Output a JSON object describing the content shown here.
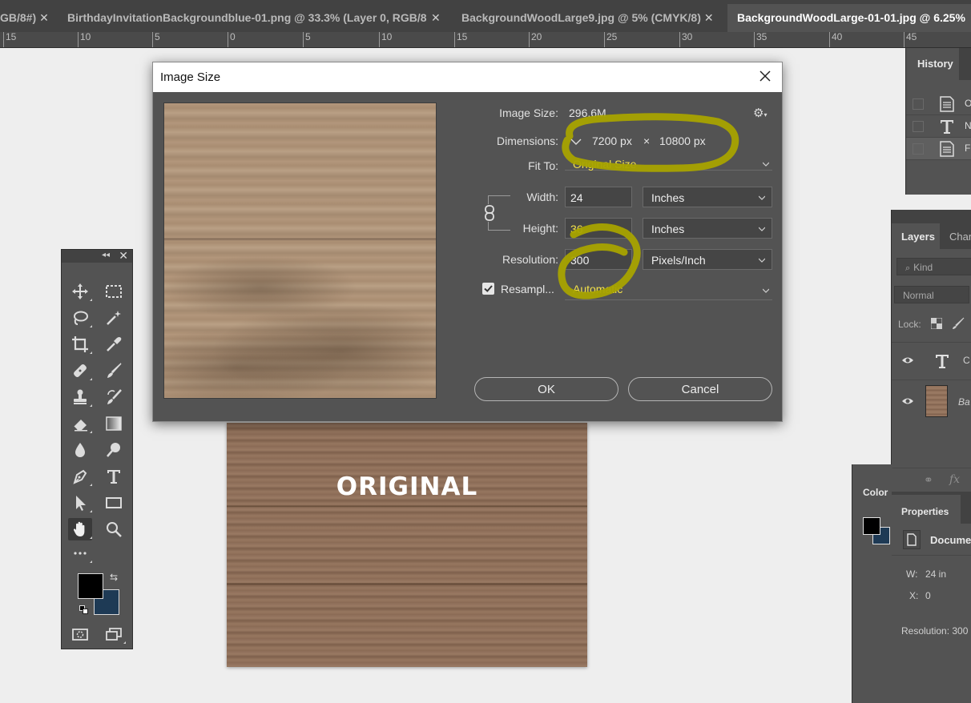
{
  "tabs": [
    {
      "label": "GB/8#)",
      "close": "✕"
    },
    {
      "label": "BirthdayInvitationBackgroundblue-01.png @ 33.3% (Layer 0, RGB/8",
      "close": "✕"
    },
    {
      "label": "BackgroundWoodLarge9.jpg @ 5% (CMYK/8)",
      "close": "✕"
    },
    {
      "label": "BackgroundWoodLarge-01-01.jpg @ 6.25%",
      "close": ""
    }
  ],
  "ruler": [
    "15",
    "10",
    "5",
    "0",
    "5",
    "10",
    "15",
    "20",
    "25",
    "30",
    "35",
    "40",
    "45"
  ],
  "canvas": {
    "text": "ORIGINAL"
  },
  "dialog": {
    "title": "Image Size",
    "image_size_label": "Image Size:",
    "image_size_value": "296.6M",
    "dimensions_label": "Dimensions:",
    "dimensions_width": "7200 px",
    "dimensions_times": "×",
    "dimensions_height": "10800 px",
    "fit_to_label": "Fit To:",
    "fit_to_value": "Original Size",
    "width_label": "Width:",
    "width_value": "24",
    "width_unit": "Inches",
    "height_label": "Height:",
    "height_value": "36",
    "height_unit": "Inches",
    "resolution_label": "Resolution:",
    "resolution_value": "300",
    "resolution_unit": "Pixels/Inch",
    "resample_label": "Resampl...",
    "resample_checked": true,
    "resample_value": "Automatic",
    "ok_label": "OK",
    "cancel_label": "Cancel"
  },
  "history": {
    "tab_label": "History",
    "items": [
      {
        "label": "O",
        "icon": "document-icon"
      },
      {
        "label": "N",
        "icon": "text-icon"
      },
      {
        "label": "F",
        "icon": "document-icon"
      }
    ]
  },
  "layers": {
    "tab_label": "Layers",
    "channels_label": "Chan",
    "kind_placeholder": "Kind",
    "blend_mode": "Normal",
    "lock_label": "Lock:",
    "rows": [
      {
        "type": "text",
        "label": "C"
      },
      {
        "type": "image",
        "label": "Ba"
      }
    ]
  },
  "color_panel": {
    "tab_label": "Color"
  },
  "properties": {
    "tab_label": "Properties",
    "doc_label": "Documen",
    "w_label": "W:",
    "w_value": "24 in",
    "x_label": "X:",
    "x_value": "0",
    "resolution_label": "Resolution: 300"
  },
  "colors": {
    "foreground": "#000000",
    "background": "#1e3a55",
    "highlight_marker": "#a8a300",
    "accent_text": "#f5e34a"
  }
}
